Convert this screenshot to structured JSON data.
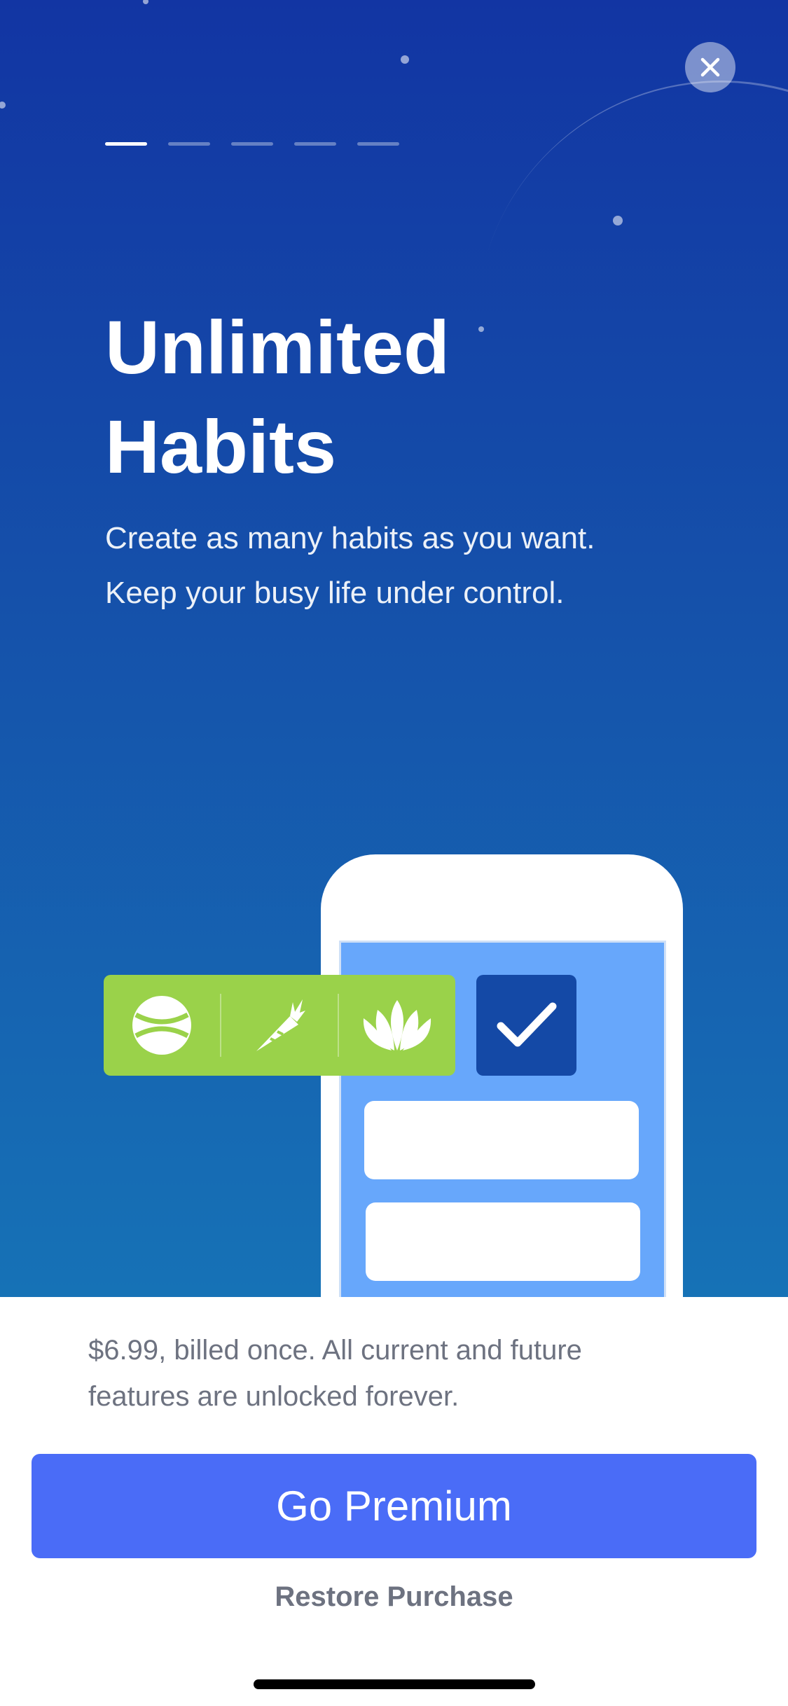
{
  "close_button": {
    "icon": "close-icon"
  },
  "pager": {
    "total": 5,
    "active_index": 0
  },
  "hero": {
    "title_line1": "Unlimited",
    "title_line2": "Habits",
    "subtitle_line1": "Create as many habits as you want.",
    "subtitle_line2": "Keep your busy life under control."
  },
  "illustration": {
    "habit_icons": [
      "tennis-ball-icon",
      "carrot-icon",
      "lotus-icon"
    ],
    "check_icon": "checkmark-icon",
    "colors": {
      "habit_strip": "#9ad24a",
      "check_box": "#1449a6",
      "phone_screen": "#67a7fb"
    }
  },
  "purchase": {
    "price_line1": "$6.99, billed once. All current and future",
    "price_line2": "features are unlocked forever.",
    "cta_label": "Go Premium",
    "restore_label": "Restore Purchase"
  },
  "colors": {
    "accent": "#4a6cf7",
    "hero_top": "#1235a3",
    "hero_bottom": "#1672b6"
  }
}
